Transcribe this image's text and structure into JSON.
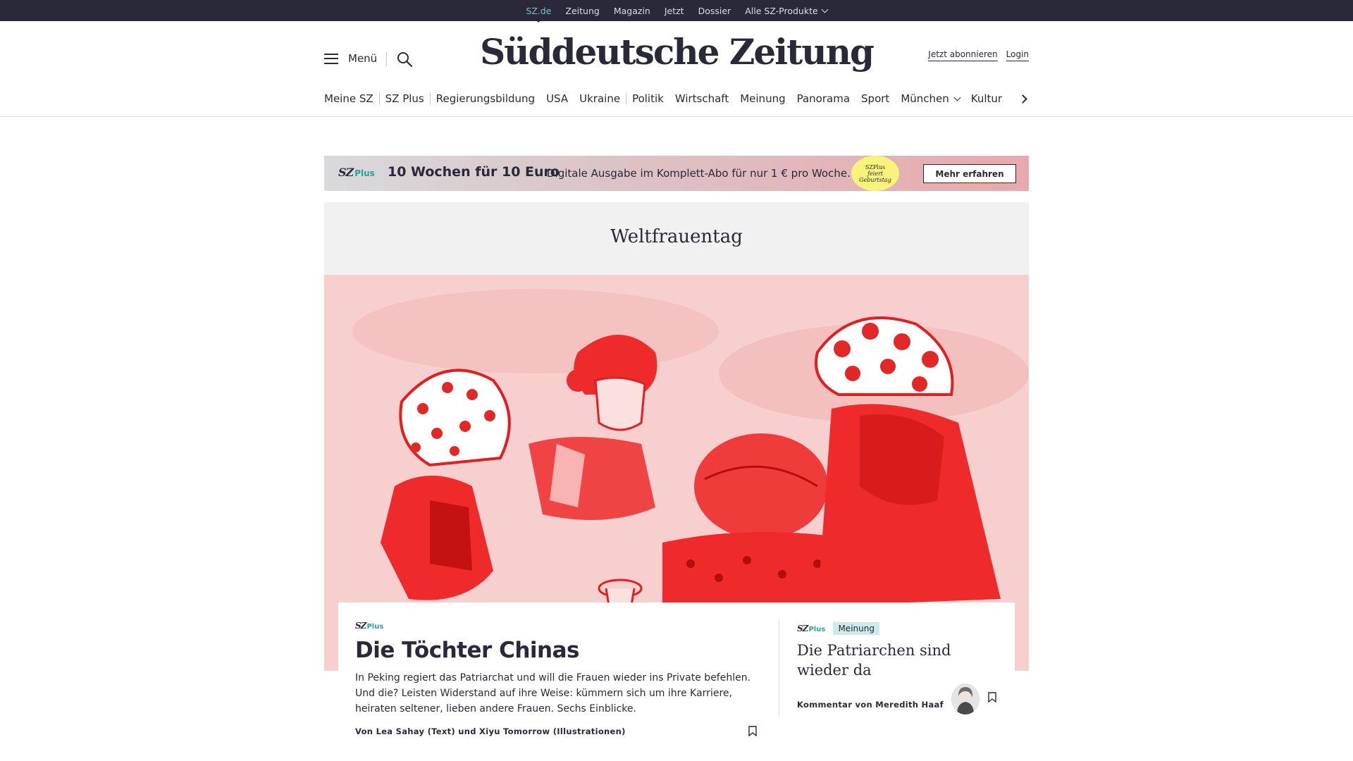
{
  "topbar": {
    "links": [
      "SZ.de",
      "Zeitung",
      "Magazin",
      "Jetzt",
      "Dossier",
      "Alle SZ-Produkte"
    ]
  },
  "header": {
    "menu_label": "Menü",
    "logo": "Süddeutsche Zeitung",
    "subscribe": "Jetzt abonnieren",
    "login": "Login"
  },
  "nav": {
    "items": [
      "Meine SZ",
      "SZ Plus",
      "Regierungsbildung",
      "USA",
      "Ukraine",
      "Politik",
      "Wirtschaft",
      "Meinung",
      "Panorama",
      "Sport",
      "München",
      "Kultur"
    ]
  },
  "promo": {
    "logo": "SZ",
    "logo_plus": "Plus",
    "headline": "10 Wochen für 10 Euro",
    "text": "Digitale Ausgabe im Komplett-Abo für nur 1 € pro Woche.",
    "badge_line1": "SZPlus",
    "badge_line2": "feiert",
    "badge_line3": "Geburtstag",
    "button": "Mehr erfahren"
  },
  "topic": {
    "title": "Weltfrauentag"
  },
  "main_article": {
    "brand": "SZ",
    "brand_plus": "Plus",
    "title": "Die Töchter Chinas",
    "teaser": "In Peking regiert das Patriarchat und will die Frauen wieder ins Private befehlen. Und die? Leisten Widerstand auf ihre Weise: kümmern sich um ihre Karriere, heiraten seltener, lieben andere Frauen. Sechs Einblicke.",
    "byline": "Von Lea Sahay (Text) und Xiyu Tomorrow (Illustrationen)"
  },
  "side_article": {
    "brand": "SZ",
    "brand_plus": "Plus",
    "tag": "Meinung",
    "title": "Die Patriarchen sind wieder da",
    "byline": "Kommentar von Meredith Haaf"
  },
  "colors": {
    "ink": "#29293a",
    "accent_teal": "#29a19c",
    "hero_red": "#ee2a2a",
    "hero_pink": "#f7cfcf",
    "badge_yellow": "#f8f37a"
  }
}
